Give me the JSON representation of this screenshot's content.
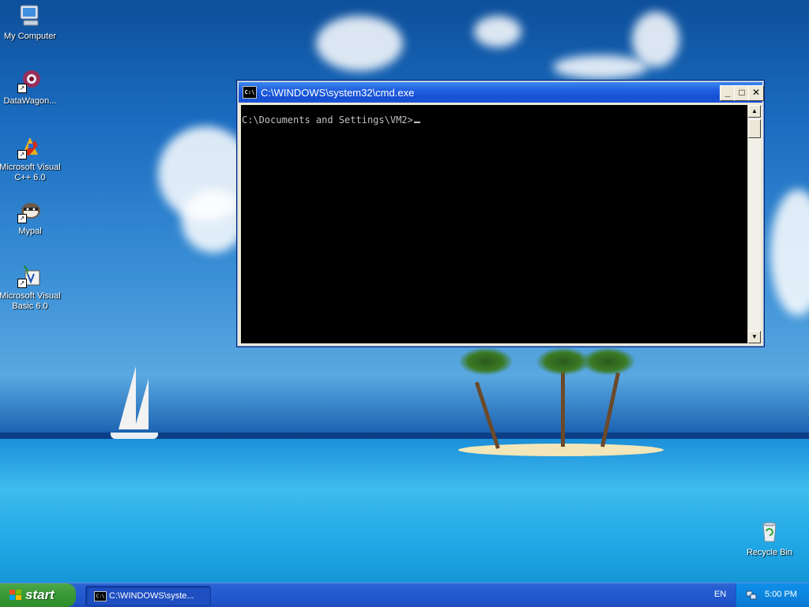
{
  "desktop": {
    "icons": [
      {
        "label": "My Computer",
        "icon": "computer-icon"
      },
      {
        "label": "DataWagon...",
        "icon": "datawagon-icon"
      },
      {
        "label": "Microsoft Visual C++ 6.0",
        "icon": "visual-cpp-icon"
      },
      {
        "label": "Mypal",
        "icon": "mypal-icon"
      },
      {
        "label": "Microsoft Visual Basic 6.0",
        "icon": "visual-basic-icon"
      },
      {
        "label": "Recycle Bin",
        "icon": "recycle-bin-icon"
      }
    ]
  },
  "cmd_window": {
    "title": "C:\\WINDOWS\\system32\\cmd.exe",
    "icon_text": "C:\\",
    "prompt": "C:\\Documents and Settings\\VM2>",
    "buttons": {
      "minimize": "_",
      "maximize": "□",
      "close": "✕"
    },
    "scroll_up": "▲",
    "scroll_down": "▼"
  },
  "taskbar": {
    "start_label": "start",
    "task_label": "C:\\WINDOWS\\syste...",
    "task_icon_text": "C:\\",
    "language": "EN",
    "clock": "5:00 PM"
  },
  "colors": {
    "titlebar": "#1f5fe0",
    "taskbar": "#245ad0",
    "start_button": "#3a9b36",
    "tray": "#0c86e0",
    "console_bg": "#000000",
    "console_text": "#c0c0c0"
  }
}
